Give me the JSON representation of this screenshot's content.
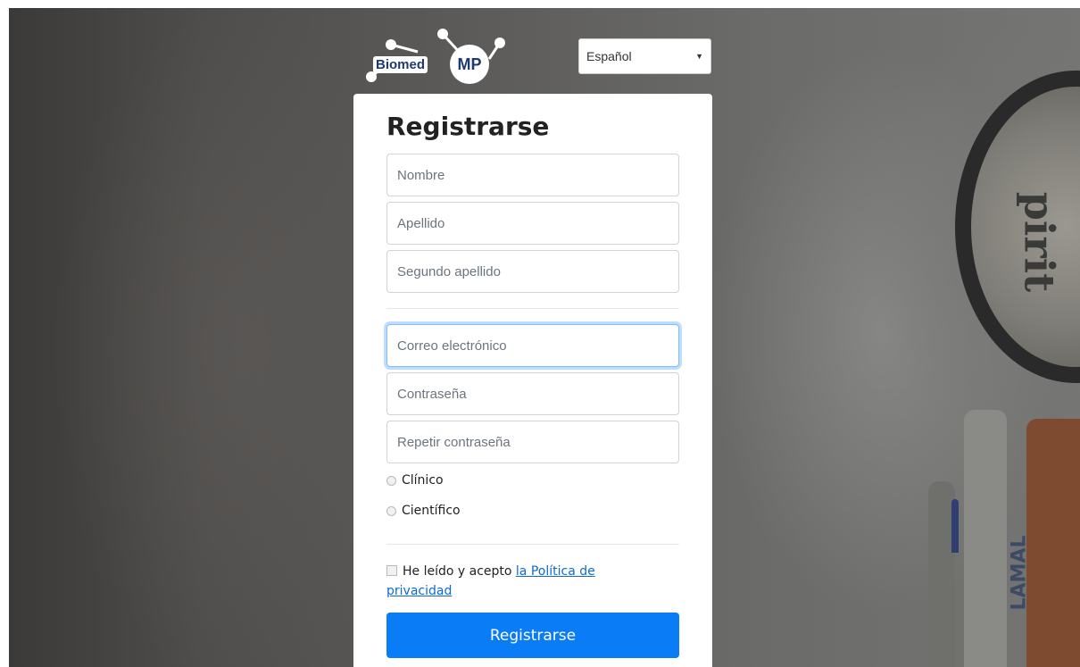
{
  "brand": {
    "word": "Biomed",
    "mark": "MP",
    "color": "#1f3a70"
  },
  "language": {
    "selected": "Español"
  },
  "form": {
    "title": "Registrarse",
    "fields": {
      "first_name": "Nombre",
      "last_name": "Apellido",
      "second_last_name": "Segundo apellido",
      "email": "Correo electrónico",
      "password": "Contraseña",
      "repeat_password": "Repetir contraseña"
    },
    "roles": [
      "Clínico",
      "Científico"
    ],
    "privacy": {
      "prefix": "He leído y acepto ",
      "link": "la Política de privacidad"
    },
    "submit": "Registrarse",
    "accent": "#0a7cf6"
  },
  "background": {
    "device_label": "pirit",
    "pen_brand": "LAMAL"
  }
}
